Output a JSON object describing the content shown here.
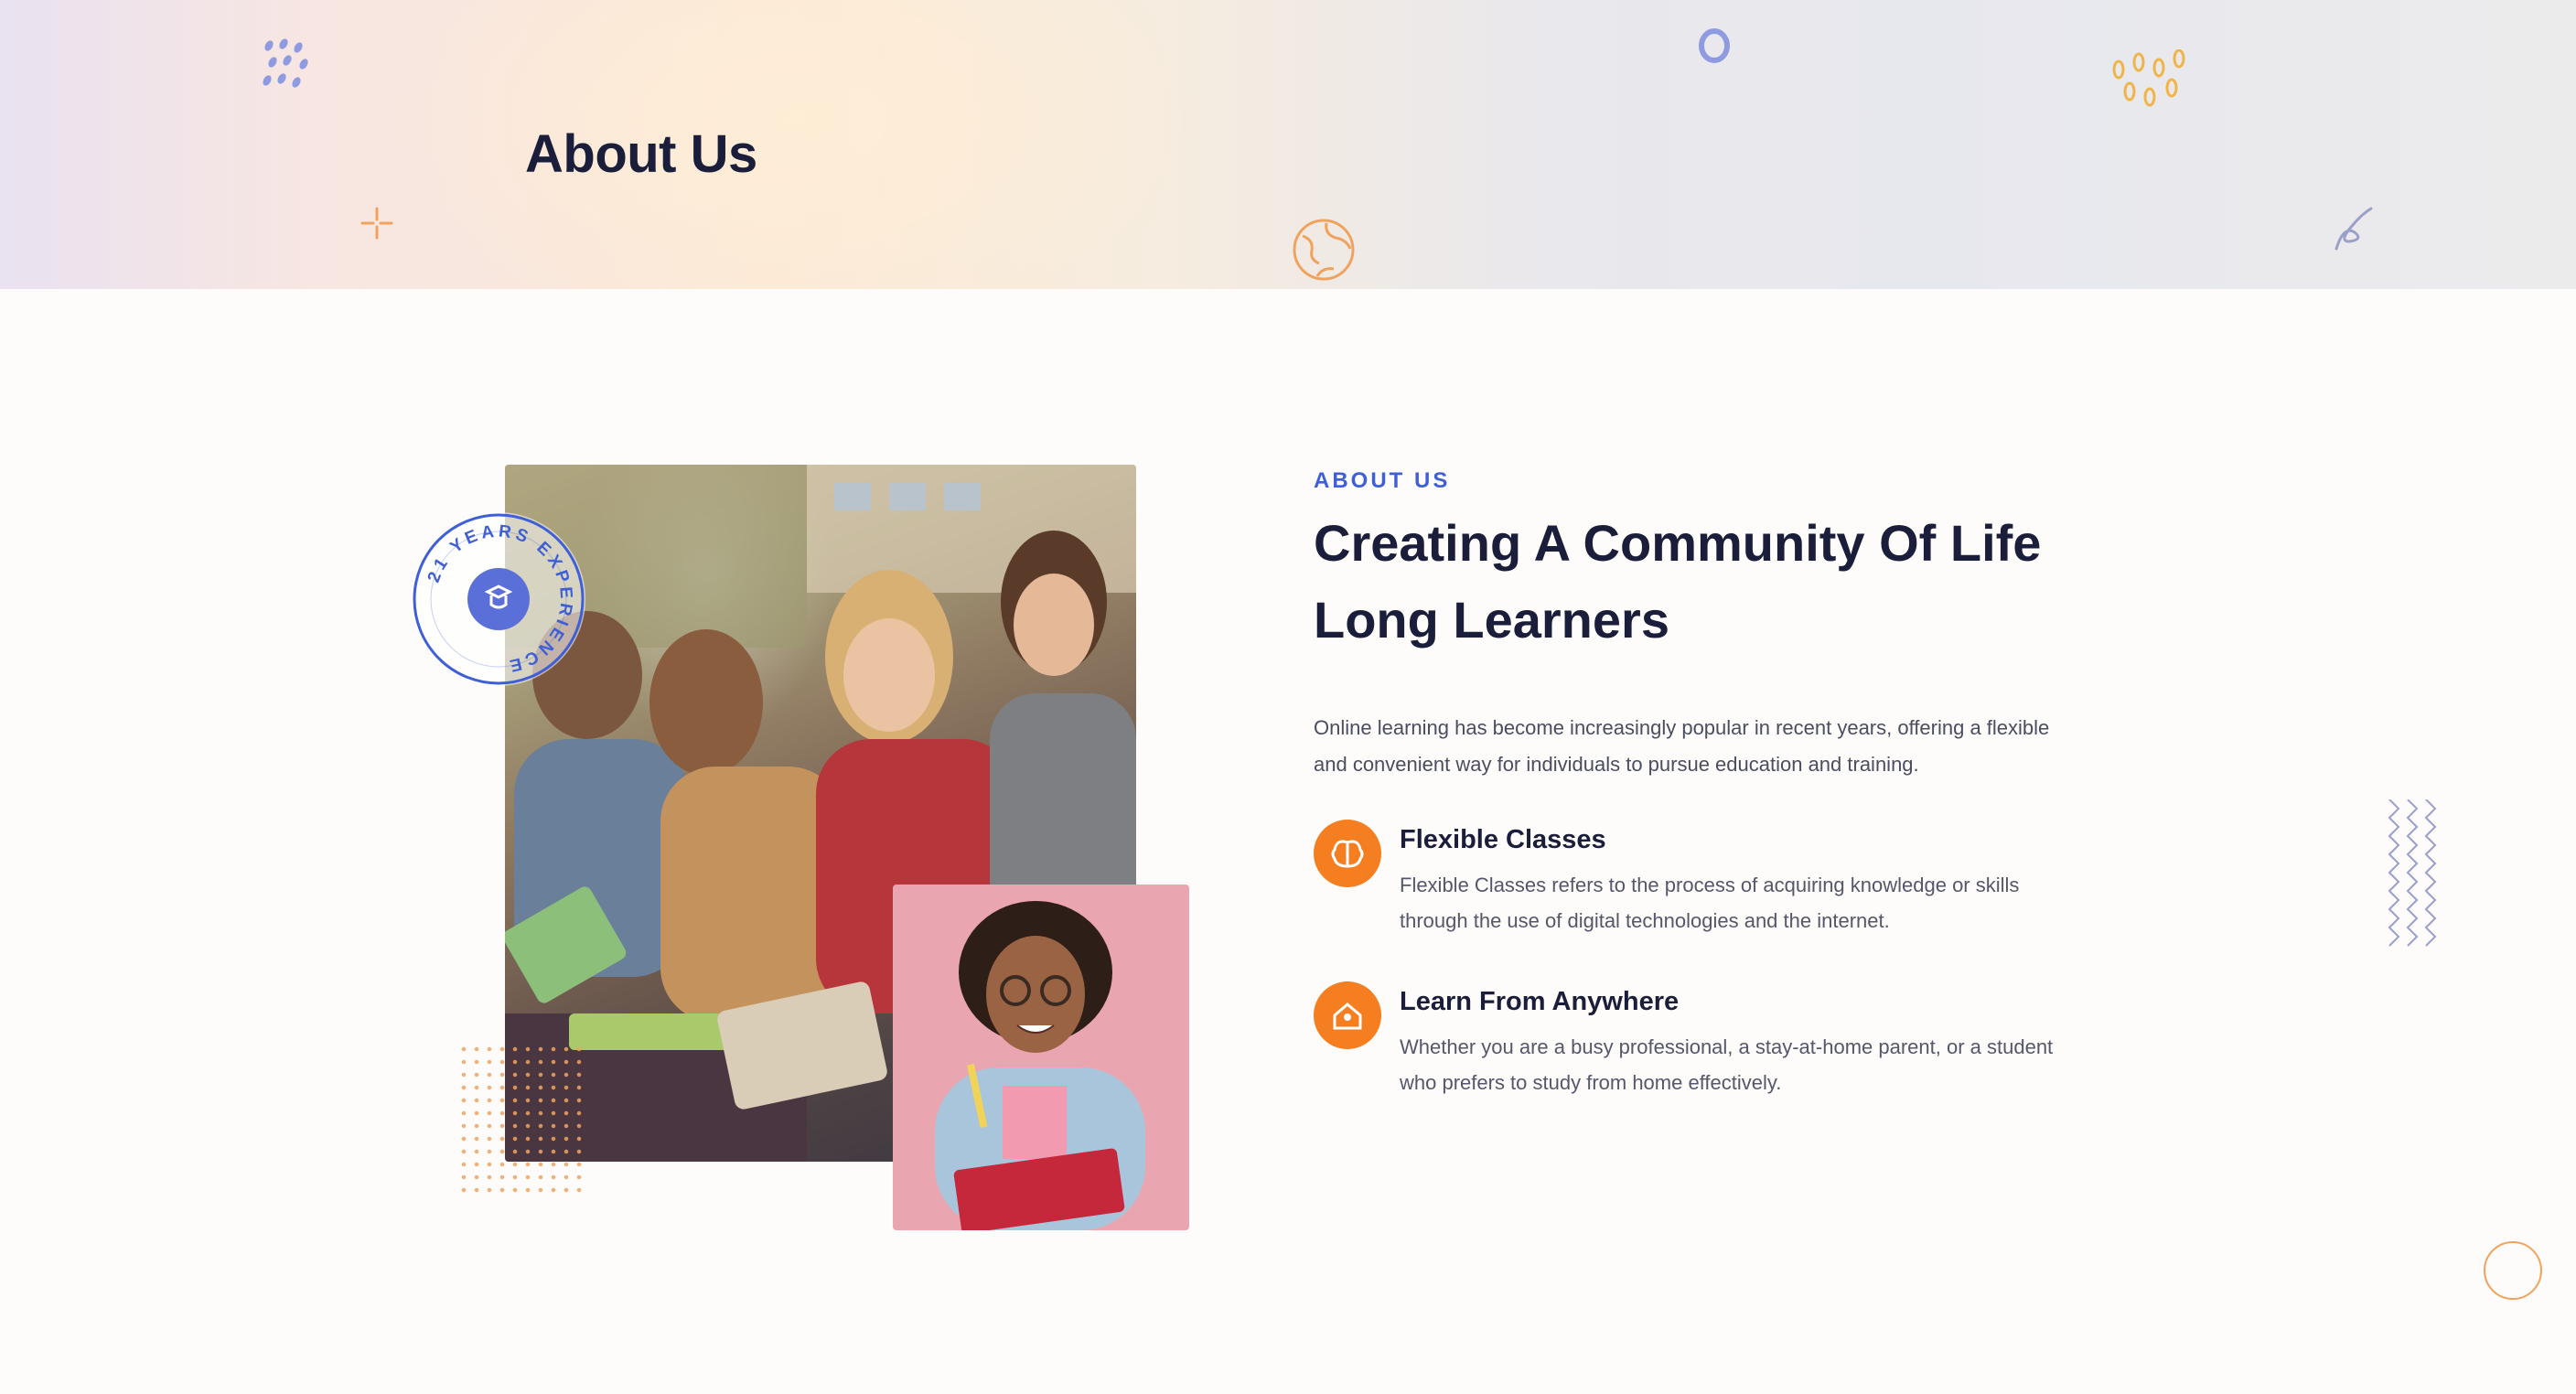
{
  "hero": {
    "title": "About Us"
  },
  "about": {
    "eyebrow": "ABOUT US",
    "heading": "Creating A Community Of Life Long Learners",
    "intro": "Online learning has become increasingly popular in recent years, offering a flexible and convenient way for individuals to pursue education and training."
  },
  "badge": {
    "text": "YEARS EXPERIENCE",
    "number": "21"
  },
  "features": [
    {
      "title": "Flexible Classes",
      "description": "Flexible Classes refers to the process of acquiring knowledge or skills through the use of digital technologies and the internet.",
      "icon": "brain-icon"
    },
    {
      "title": "Learn From Anywhere",
      "description": "Whether you are a busy professional, a stay-at-home parent, or a student who prefers to study from home effectively.",
      "icon": "house-icon"
    }
  ],
  "colors": {
    "accent_blue": "#3f5fd6",
    "accent_orange": "#f57f20",
    "heading": "#1b1e3a"
  }
}
